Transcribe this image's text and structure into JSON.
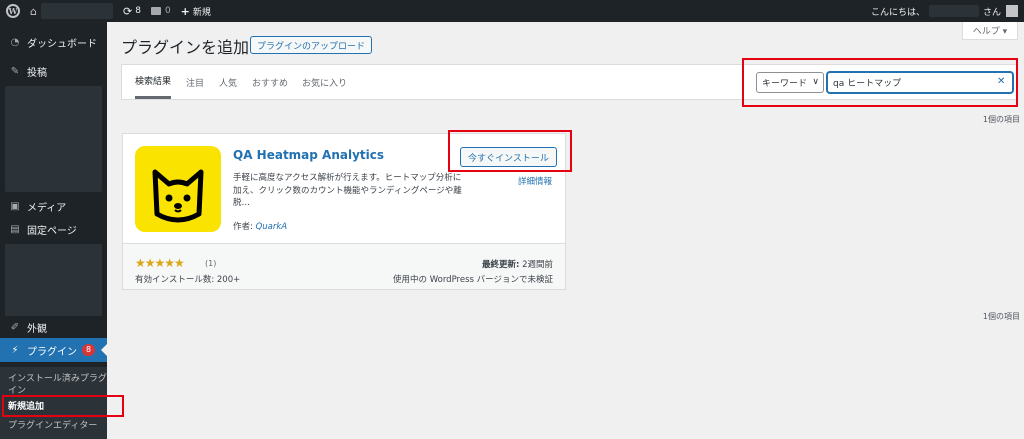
{
  "adminbar": {
    "updates_count": "8",
    "comments_count": "0",
    "new_label": "新規",
    "greeting": "こんにちは、",
    "san": "さん"
  },
  "sidebar": {
    "dashboard": "ダッシュボード",
    "posts": "投稿",
    "media": "メディア",
    "pages": "固定ページ",
    "appearance": "外観",
    "plugins": "プラグイン",
    "plugins_badge": "8",
    "submenu": {
      "installed_line1": "インストール済みプラグ",
      "installed_line2": "イン",
      "add_new": "新規追加",
      "editor": "プラグインエディター"
    }
  },
  "header": {
    "title": "プラグインを追加",
    "upload_button": "プラグインのアップロード",
    "help": "ヘルプ ▾"
  },
  "filter": {
    "tabs": [
      "検索結果",
      "注目",
      "人気",
      "おすすめ",
      "お気に入り"
    ],
    "search_type": "キーワード",
    "search_value": "qa ヒートマップ"
  },
  "results": {
    "count_top": "1個の項目",
    "count_bottom": "1個の項目"
  },
  "plugin": {
    "name": "QA Heatmap Analytics",
    "description": "手軽に高度なアクセス解析が行えます。ヒートマップ分析に加え、クリック数のカウント機能やランディングページや離脱…",
    "author_label": "作者: ",
    "author": "QuarkA",
    "install_button": "今すぐインストール",
    "details_link": "詳細情報",
    "stars": "★★★★★",
    "rating": 5,
    "rating_count": "(1)",
    "installs": "有効インストール数: 200+",
    "last_updated_label": "最終更新:",
    "last_updated_value": " 2週間前",
    "compatibility": "使用中の WordPress バージョンで未検証"
  },
  "colors": {
    "accent": "#2271b1",
    "highlight_box": "#e50012",
    "sidebar_bg": "#1d2327",
    "icon_yellow": "#fbe300"
  }
}
